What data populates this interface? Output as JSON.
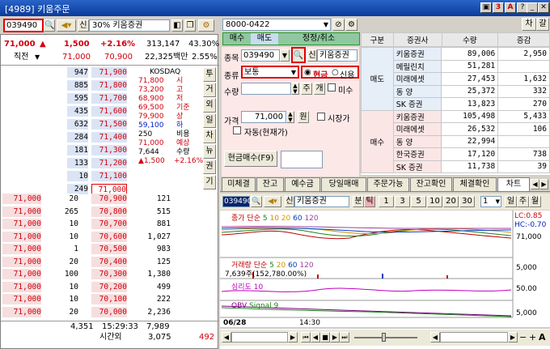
{
  "window": {
    "title": "[4989] 키움주문"
  },
  "left_toolbar": {
    "code": "039490",
    "credit_label": "신",
    "margin_label": "30%",
    "stock_name": "키움증권"
  },
  "summary": {
    "price": "71,000",
    "change": "1,500",
    "rate": "+2.16%",
    "volume": "313,147",
    "vol_ratio": "43.30%",
    "mode": "직전",
    "prev_price": "71,000",
    "base_price": "70,900",
    "trade_value": "22,325백만",
    "turnover": "2.55%"
  },
  "asks": [
    {
      "qty": "947",
      "price": "71,900"
    },
    {
      "qty": "885",
      "price": "71,800"
    },
    {
      "qty": "595",
      "price": "71,700"
    },
    {
      "qty": "435",
      "price": "71,600"
    },
    {
      "qty": "632",
      "price": "71,500"
    },
    {
      "qty": "284",
      "price": "71,400"
    },
    {
      "qty": "181",
      "price": "71,300"
    },
    {
      "qty": "133",
      "price": "71,200"
    },
    {
      "qty": "10",
      "price": "71,100"
    },
    {
      "qty": "249",
      "price": "71,000"
    }
  ],
  "info_panel": [
    {
      "v": "KOSDAQ",
      "k": ""
    },
    {
      "v": "71,800",
      "k": "시"
    },
    {
      "v": "73,200",
      "k": "고"
    },
    {
      "v": "68,900",
      "k": "저"
    },
    {
      "v": "69,500",
      "k": "기준"
    },
    {
      "v": "79,900",
      "k": "상"
    },
    {
      "v": "59,100",
      "k": "하"
    },
    {
      "v": "250",
      "k": "비용"
    },
    {
      "v": "71,000",
      "k": "예상"
    },
    {
      "v": "7,644",
      "k": "수량"
    },
    {
      "v": "▲1,500",
      "k": "+2.16%"
    }
  ],
  "side_tabs": [
    "투",
    "거",
    "외",
    "일",
    "차",
    "뉴",
    "권",
    "기"
  ],
  "bids": [
    {
      "mine": "71,000",
      "qty": "20",
      "price": "70,900",
      "vol": "121"
    },
    {
      "mine": "71,000",
      "qty": "265",
      "price": "70,800",
      "vol": "515"
    },
    {
      "mine": "71,000",
      "qty": "10",
      "price": "70,700",
      "vol": "881"
    },
    {
      "mine": "71,000",
      "qty": "10",
      "price": "70,600",
      "vol": "1,027"
    },
    {
      "mine": "71,000",
      "qty": "1",
      "price": "70,500",
      "vol": "983"
    },
    {
      "mine": "71,000",
      "qty": "20",
      "price": "70,400",
      "vol": "125"
    },
    {
      "mine": "71,000",
      "qty": "100",
      "price": "70,300",
      "vol": "1,380"
    },
    {
      "mine": "71,000",
      "qty": "10",
      "price": "70,200",
      "vol": "499"
    },
    {
      "mine": "71,000",
      "qty": "10",
      "price": "70,100",
      "vol": "222"
    },
    {
      "mine": "71,000",
      "qty": "20",
      "price": "70,000",
      "vol": "2,236"
    }
  ],
  "book_footer": {
    "ask_total": "4,351",
    "time": "15:29:33",
    "bid_total": "7,989",
    "after_label": "시간외",
    "after_bid": "3,075",
    "after_ask": "492"
  },
  "order": {
    "account": "8000-0422",
    "tabs": [
      "매수",
      "매도",
      "정정/취소"
    ],
    "code_label": "종목",
    "code": "039490",
    "credit": "신",
    "stock_name": "키움증권",
    "type_label": "종류",
    "type_value": "보통",
    "cash_label": "현금",
    "credit_opt": "신용",
    "qty_label": "수량",
    "ju": "주",
    "lot": "개",
    "misu": "미수",
    "price_label": "가격",
    "price_value": "71,000",
    "won": "원",
    "market_price": "시장가",
    "auto_label": "자동(현재가)",
    "submit": "현금매수(F9)"
  },
  "broker": {
    "reset": "차",
    "col2": "갈",
    "headers": [
      "구분",
      "증권사",
      "수량",
      "증감"
    ],
    "sell_label": "매도",
    "sell": [
      {
        "name": "키움증권",
        "qty": "89,006",
        "diff": "2,950"
      },
      {
        "name": "메릴린치",
        "qty": "51,281",
        "diff": ""
      },
      {
        "name": "미래에셋",
        "qty": "27,453",
        "diff": "1,632"
      },
      {
        "name": "동    양",
        "qty": "25,372",
        "diff": "332"
      },
      {
        "name": "SK  증권",
        "qty": "13,823",
        "diff": "270"
      }
    ],
    "buy_label": "매수",
    "buy": [
      {
        "name": "키움증권",
        "qty": "105,498",
        "diff": "5,433"
      },
      {
        "name": "미래에셋",
        "qty": "26,532",
        "diff": "106"
      },
      {
        "name": "동    양",
        "qty": "22,994",
        "diff": ""
      },
      {
        "name": "한국증권",
        "qty": "17,120",
        "diff": "738"
      },
      {
        "name": "SK  증권",
        "qty": "11,738",
        "diff": "39"
      }
    ]
  },
  "bottom_tabs": [
    "미체결",
    "잔고",
    "예수금",
    "당일매매",
    "주문가능",
    "잔고확인",
    "체결확인",
    "차트"
  ],
  "chart_bar": {
    "code": "039490",
    "credit": "신",
    "stock_name": "키움증권",
    "btn_bun": "분",
    "btn_tick": "틱",
    "intervals": [
      "1",
      "3",
      "5",
      "10",
      "20",
      "30"
    ],
    "sel": "1",
    "btn_day": "일",
    "btn_week": "주",
    "btn_month": "월"
  },
  "chart": {
    "price_legend": [
      "종가 단순",
      "5",
      "10",
      "20",
      "60",
      "120"
    ],
    "lc": "LC:0.85",
    "hc": "HC:-0.70",
    "price_tick": "71,000",
    "vol_legend": [
      "거래량 단순",
      "5",
      "20",
      "60",
      "120"
    ],
    "vol_value": "7,639주(152,780.00%)",
    "vol_tick": "5,000",
    "psy_label": "심리도",
    "psy_param": "10",
    "psy_tick": "50.00",
    "obv_label": "OBV",
    "obv_signal": "Signal 9",
    "obv_tick": "5,000",
    "date": "06/28",
    "time": "14:30"
  },
  "colors": {
    "up": "#d0000d",
    "down": "#0020c0",
    "ask_bg": "#dbe4f5",
    "bid_bg": "#f6dede",
    "title_bg": "#0a3a9a"
  }
}
